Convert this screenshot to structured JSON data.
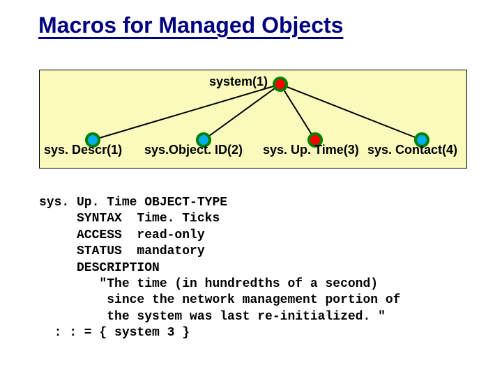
{
  "title": "Macros for Managed Objects",
  "tree": {
    "root": "system(1)",
    "leaves": [
      "sys. Descr(1)",
      "sys.Object. ID(2)",
      "sys. Up. Time(3)",
      "sys. Contact(4)"
    ]
  },
  "macro": {
    "l1": "sys. Up. Time OBJECT-TYPE",
    "l2": "     SYNTAX  Time. Ticks",
    "l3": "     ACCESS  read-only",
    "l4": "     STATUS  mandatory",
    "l5": "     DESCRIPTION",
    "l6": "        \"The time (in hundredths of a second)",
    "l7": "         since the network management portion of",
    "l8": "         the system was last re-initialized. \"",
    "l9": "  : : = { system 3 }"
  },
  "colors": {
    "title": "#000080",
    "box_bg": "#fafabd",
    "root_node_fill": "#ff0000",
    "leaf_fill_blue": "#00aeef",
    "leaf_fill_red": "#ff0000",
    "node_stroke": "#008000",
    "edge": "#000000"
  }
}
